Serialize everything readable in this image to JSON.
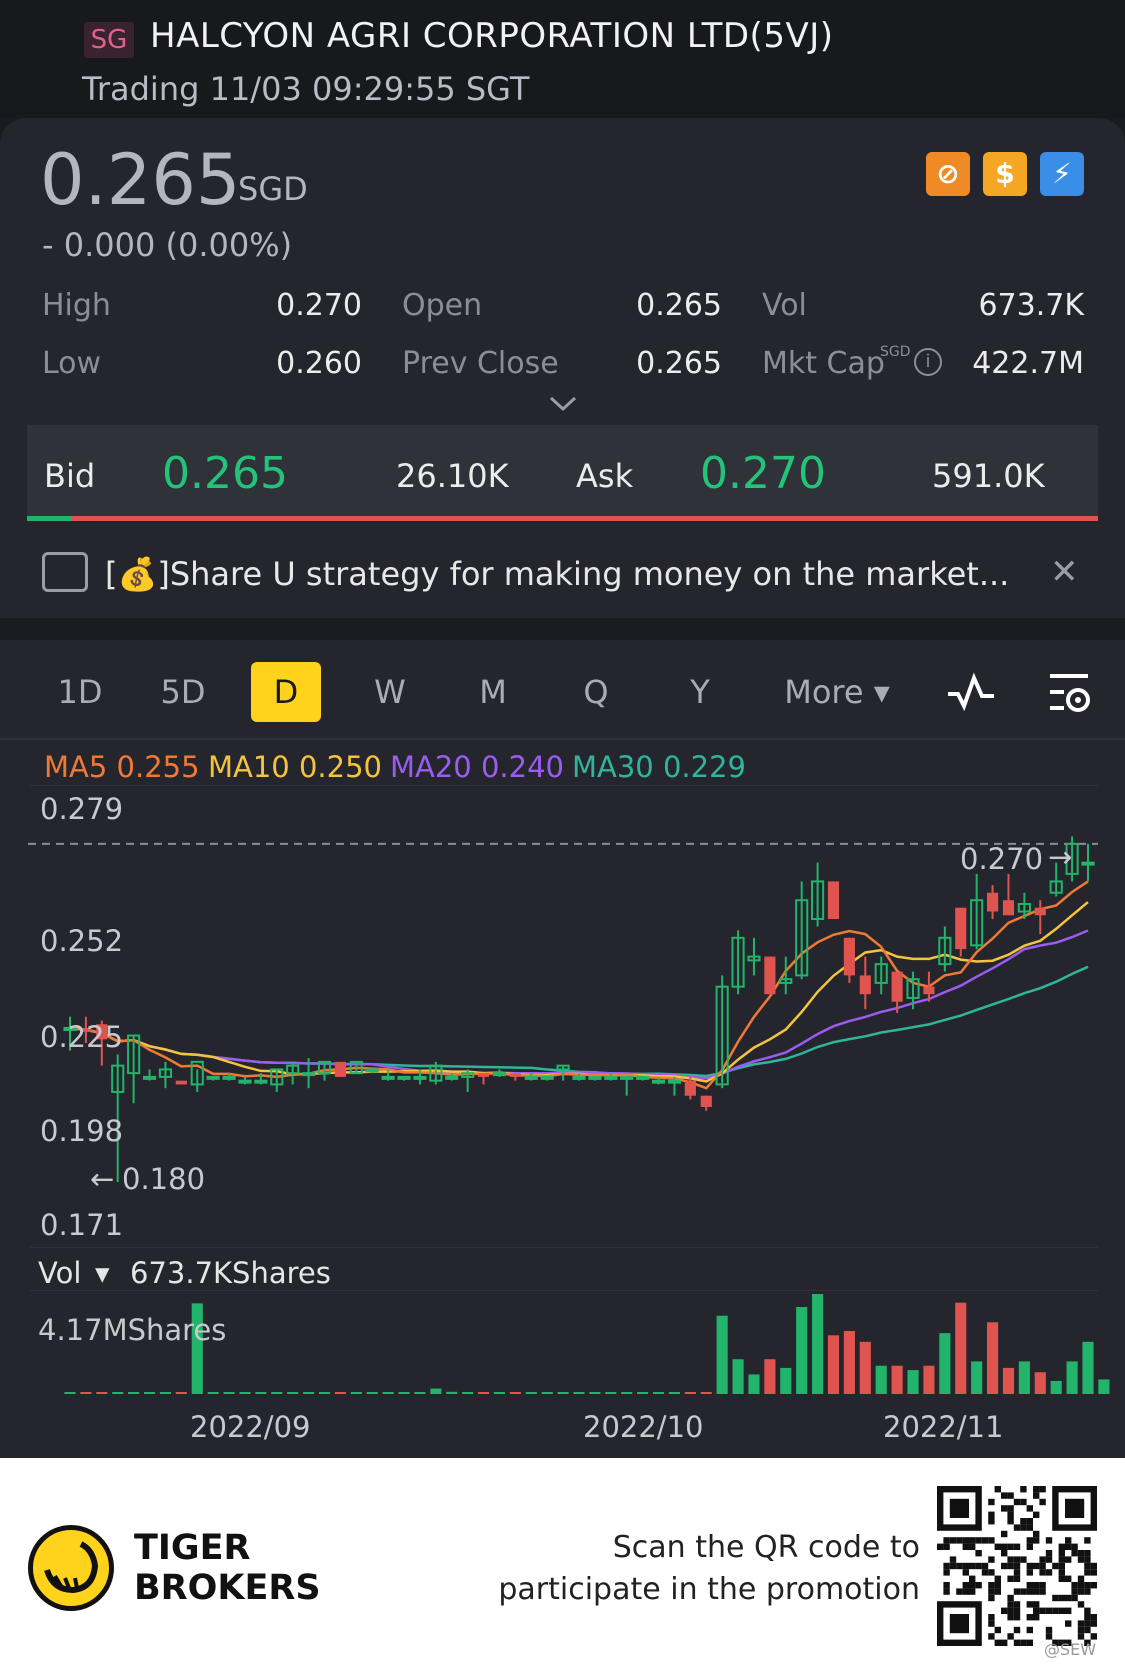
{
  "header": {
    "market_badge": "SG",
    "title": "HALCYON AGRI CORPORATION LTD(5VJ)",
    "status": "Trading 11/03 09:29:55 SGT"
  },
  "quote": {
    "price": "0.265",
    "currency": "SGD",
    "change": "- 0.000 (0.00%)",
    "stats": {
      "high_label": "High",
      "high": "0.270",
      "low_label": "Low",
      "low": "0.260",
      "open_label": "Open",
      "open": "0.265",
      "prev_close_label": "Prev Close",
      "prev_close": "0.265",
      "vol_label": "Vol",
      "vol": "673.7K",
      "mkt_cap_label": "Mkt Cap",
      "mkt_cap_unit": "SGD",
      "mkt_cap": "422.7M"
    },
    "badges": [
      "no-margin-icon",
      "dollar-icon",
      "lightning-icon"
    ],
    "badge_colors": [
      "#f08a24",
      "#f5a623",
      "#3a8ee8"
    ]
  },
  "orderbook": {
    "bid_label": "Bid",
    "bid_price": "0.265",
    "bid_size": "26.10K",
    "ask_label": "Ask",
    "ask_price": "0.270",
    "ask_size": "591.0K"
  },
  "promo": {
    "prefix": "[",
    "emoji": "💰",
    "text": "]Share U strategy for making money on the market..."
  },
  "tabs": [
    "1D",
    "5D",
    "D",
    "W",
    "M",
    "Q",
    "Y",
    "More ▾"
  ],
  "active_tab": "D",
  "indicators": {
    "ma5": "MA5 0.255",
    "ma10": "MA10 0.250",
    "ma20": "MA20 0.240",
    "ma30": "MA30 0.229",
    "colors": {
      "ma5": "#f07a35",
      "ma10": "#f3c43c",
      "ma20": "#9b5cf0",
      "ma30": "#2fb59c",
      "up": "#21b46a",
      "down": "#e0544f"
    }
  },
  "price_axis": [
    "0.279",
    "0.252",
    "0.225",
    "0.198",
    "0.171"
  ],
  "annotations": {
    "high_mark": "0.270",
    "low_mark": "0.180"
  },
  "volume": {
    "label": "Vol",
    "current": "673.7KShares",
    "max_label": "4.17MShares"
  },
  "date_axis": [
    "2022/09",
    "2022/10",
    "2022/11"
  ],
  "footer": {
    "brand_line1": "TIGER",
    "brand_line2": "BROKERS",
    "scan_line1": "Scan the QR code to",
    "scan_line2": "participate in the promotion",
    "watermark": "@SEW"
  },
  "chart_data": {
    "type": "candlestick",
    "ylim": [
      0.171,
      0.279
    ],
    "candles": [
      {
        "o": 0.221,
        "h": 0.224,
        "l": 0.215,
        "c": 0.221
      },
      {
        "o": 0.221,
        "h": 0.224,
        "l": 0.217,
        "c": 0.22
      },
      {
        "o": 0.222,
        "h": 0.223,
        "l": 0.211,
        "c": 0.218
      },
      {
        "o": 0.204,
        "h": 0.214,
        "l": 0.18,
        "c": 0.211
      },
      {
        "o": 0.209,
        "h": 0.219,
        "l": 0.201,
        "c": 0.219
      },
      {
        "o": 0.208,
        "h": 0.21,
        "l": 0.207,
        "c": 0.208
      },
      {
        "o": 0.208,
        "h": 0.212,
        "l": 0.205,
        "c": 0.21
      },
      {
        "o": 0.207,
        "h": 0.207,
        "l": 0.206,
        "c": 0.206
      },
      {
        "o": 0.206,
        "h": 0.21,
        "l": 0.204,
        "c": 0.212
      },
      {
        "o": 0.208,
        "h": 0.208,
        "l": 0.207,
        "c": 0.208
      },
      {
        "o": 0.208,
        "h": 0.209,
        "l": 0.207,
        "c": 0.208
      },
      {
        "o": 0.207,
        "h": 0.208,
        "l": 0.206,
        "c": 0.207
      },
      {
        "o": 0.207,
        "h": 0.209,
        "l": 0.206,
        "c": 0.207
      },
      {
        "o": 0.206,
        "h": 0.21,
        "l": 0.204,
        "c": 0.21
      },
      {
        "o": 0.209,
        "h": 0.212,
        "l": 0.206,
        "c": 0.211
      },
      {
        "o": 0.209,
        "h": 0.213,
        "l": 0.205,
        "c": 0.209
      },
      {
        "o": 0.209,
        "h": 0.212,
        "l": 0.207,
        "c": 0.212
      },
      {
        "o": 0.212,
        "h": 0.212,
        "l": 0.208,
        "c": 0.208
      },
      {
        "o": 0.209,
        "h": 0.212,
        "l": 0.209,
        "c": 0.212
      },
      {
        "o": 0.21,
        "h": 0.21,
        "l": 0.209,
        "c": 0.21
      },
      {
        "o": 0.208,
        "h": 0.21,
        "l": 0.207,
        "c": 0.208
      },
      {
        "o": 0.208,
        "h": 0.208,
        "l": 0.207,
        "c": 0.208
      },
      {
        "o": 0.208,
        "h": 0.21,
        "l": 0.206,
        "c": 0.208
      },
      {
        "o": 0.207,
        "h": 0.212,
        "l": 0.206,
        "c": 0.211
      },
      {
        "o": 0.208,
        "h": 0.209,
        "l": 0.207,
        "c": 0.208
      },
      {
        "o": 0.208,
        "h": 0.21,
        "l": 0.204,
        "c": 0.209
      },
      {
        "o": 0.209,
        "h": 0.209,
        "l": 0.206,
        "c": 0.208
      },
      {
        "o": 0.209,
        "h": 0.21,
        "l": 0.208,
        "c": 0.209
      },
      {
        "o": 0.209,
        "h": 0.209,
        "l": 0.207,
        "c": 0.208
      },
      {
        "o": 0.208,
        "h": 0.209,
        "l": 0.207,
        "c": 0.208
      },
      {
        "o": 0.208,
        "h": 0.208,
        "l": 0.207,
        "c": 0.208
      },
      {
        "o": 0.21,
        "h": 0.211,
        "l": 0.207,
        "c": 0.211
      },
      {
        "o": 0.208,
        "h": 0.209,
        "l": 0.207,
        "c": 0.208
      },
      {
        "o": 0.208,
        "h": 0.208,
        "l": 0.207,
        "c": 0.208
      },
      {
        "o": 0.208,
        "h": 0.209,
        "l": 0.207,
        "c": 0.208
      },
      {
        "o": 0.208,
        "h": 0.208,
        "l": 0.203,
        "c": 0.208
      },
      {
        "o": 0.208,
        "h": 0.208,
        "l": 0.207,
        "c": 0.208
      },
      {
        "o": 0.207,
        "h": 0.208,
        "l": 0.206,
        "c": 0.207
      },
      {
        "o": 0.207,
        "h": 0.208,
        "l": 0.203,
        "c": 0.207
      },
      {
        "o": 0.207,
        "h": 0.208,
        "l": 0.202,
        "c": 0.203
      },
      {
        "o": 0.203,
        "h": 0.203,
        "l": 0.199,
        "c": 0.2
      },
      {
        "o": 0.206,
        "h": 0.235,
        "l": 0.205,
        "c": 0.232
      },
      {
        "o": 0.232,
        "h": 0.247,
        "l": 0.23,
        "c": 0.245
      },
      {
        "o": 0.239,
        "h": 0.245,
        "l": 0.235,
        "c": 0.24
      },
      {
        "o": 0.24,
        "h": 0.24,
        "l": 0.23,
        "c": 0.23
      },
      {
        "o": 0.233,
        "h": 0.24,
        "l": 0.23,
        "c": 0.234
      },
      {
        "o": 0.235,
        "h": 0.26,
        "l": 0.234,
        "c": 0.255
      },
      {
        "o": 0.25,
        "h": 0.265,
        "l": 0.248,
        "c": 0.26
      },
      {
        "o": 0.26,
        "h": 0.26,
        "l": 0.25,
        "c": 0.25
      },
      {
        "o": 0.245,
        "h": 0.245,
        "l": 0.233,
        "c": 0.235
      },
      {
        "o": 0.235,
        "h": 0.24,
        "l": 0.226,
        "c": 0.23
      },
      {
        "o": 0.233,
        "h": 0.24,
        "l": 0.23,
        "c": 0.238
      },
      {
        "o": 0.236,
        "h": 0.236,
        "l": 0.225,
        "c": 0.228
      },
      {
        "o": 0.229,
        "h": 0.236,
        "l": 0.226,
        "c": 0.234
      },
      {
        "o": 0.232,
        "h": 0.236,
        "l": 0.228,
        "c": 0.23
      },
      {
        "o": 0.238,
        "h": 0.248,
        "l": 0.236,
        "c": 0.245
      },
      {
        "o": 0.253,
        "h": 0.253,
        "l": 0.24,
        "c": 0.242
      },
      {
        "o": 0.243,
        "h": 0.262,
        "l": 0.242,
        "c": 0.255
      },
      {
        "o": 0.257,
        "h": 0.259,
        "l": 0.25,
        "c": 0.252
      },
      {
        "o": 0.255,
        "h": 0.262,
        "l": 0.251,
        "c": 0.251
      },
      {
        "o": 0.252,
        "h": 0.257,
        "l": 0.25,
        "c": 0.254
      },
      {
        "o": 0.253,
        "h": 0.255,
        "l": 0.246,
        "c": 0.251
      },
      {
        "o": 0.257,
        "h": 0.265,
        "l": 0.256,
        "c": 0.26
      },
      {
        "o": 0.262,
        "h": 0.272,
        "l": 0.26,
        "c": 0.27
      },
      {
        "o": 0.265,
        "h": 0.27,
        "l": 0.26,
        "c": 0.265
      }
    ],
    "volume_millions": [
      0.05,
      0.02,
      0.03,
      0.02,
      0.02,
      0.02,
      0.02,
      0.02,
      4.17,
      0.01,
      0.01,
      0.01,
      0.01,
      0.01,
      0.01,
      0.01,
      0.01,
      0.01,
      0.01,
      0.01,
      0.01,
      0.01,
      0.01,
      0.25,
      0.1,
      0.03,
      0.01,
      0.01,
      0.01,
      0.01,
      0.01,
      0.01,
      0.01,
      0.01,
      0.01,
      0.01,
      0.01,
      0.01,
      0.01,
      0.01,
      0.05,
      3.6,
      1.6,
      0.9,
      1.6,
      1.2,
      4.0,
      4.6,
      2.7,
      2.9,
      2.4,
      1.3,
      1.3,
      1.1,
      1.3,
      2.8,
      4.2,
      1.5,
      3.3,
      1.2,
      1.5,
      1.0,
      0.6,
      1.5,
      2.4,
      0.67
    ]
  }
}
